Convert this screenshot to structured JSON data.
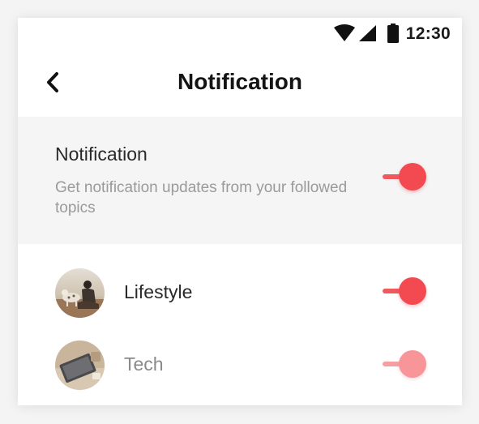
{
  "status_bar": {
    "time": "12:30",
    "icons": [
      "wifi-icon",
      "cellular-signal-icon",
      "battery-icon"
    ]
  },
  "header": {
    "back_icon": "chevron-left-icon",
    "title": "Notification"
  },
  "master_setting": {
    "title": "Notification",
    "description": "Get notification updates from your followed topics",
    "enabled": true
  },
  "topics": [
    {
      "label": "Lifestyle",
      "enabled": true,
      "text_color": "#2a2a2a",
      "avatar": "lifestyle-photo"
    },
    {
      "label": "Tech",
      "enabled": true,
      "text_color": "#8a8a8a",
      "avatar": "tech-photo"
    }
  ],
  "colors": {
    "accent": "#f34a51",
    "panel_background": "#f5f5f5",
    "secondary_text": "#9a9a9a"
  }
}
